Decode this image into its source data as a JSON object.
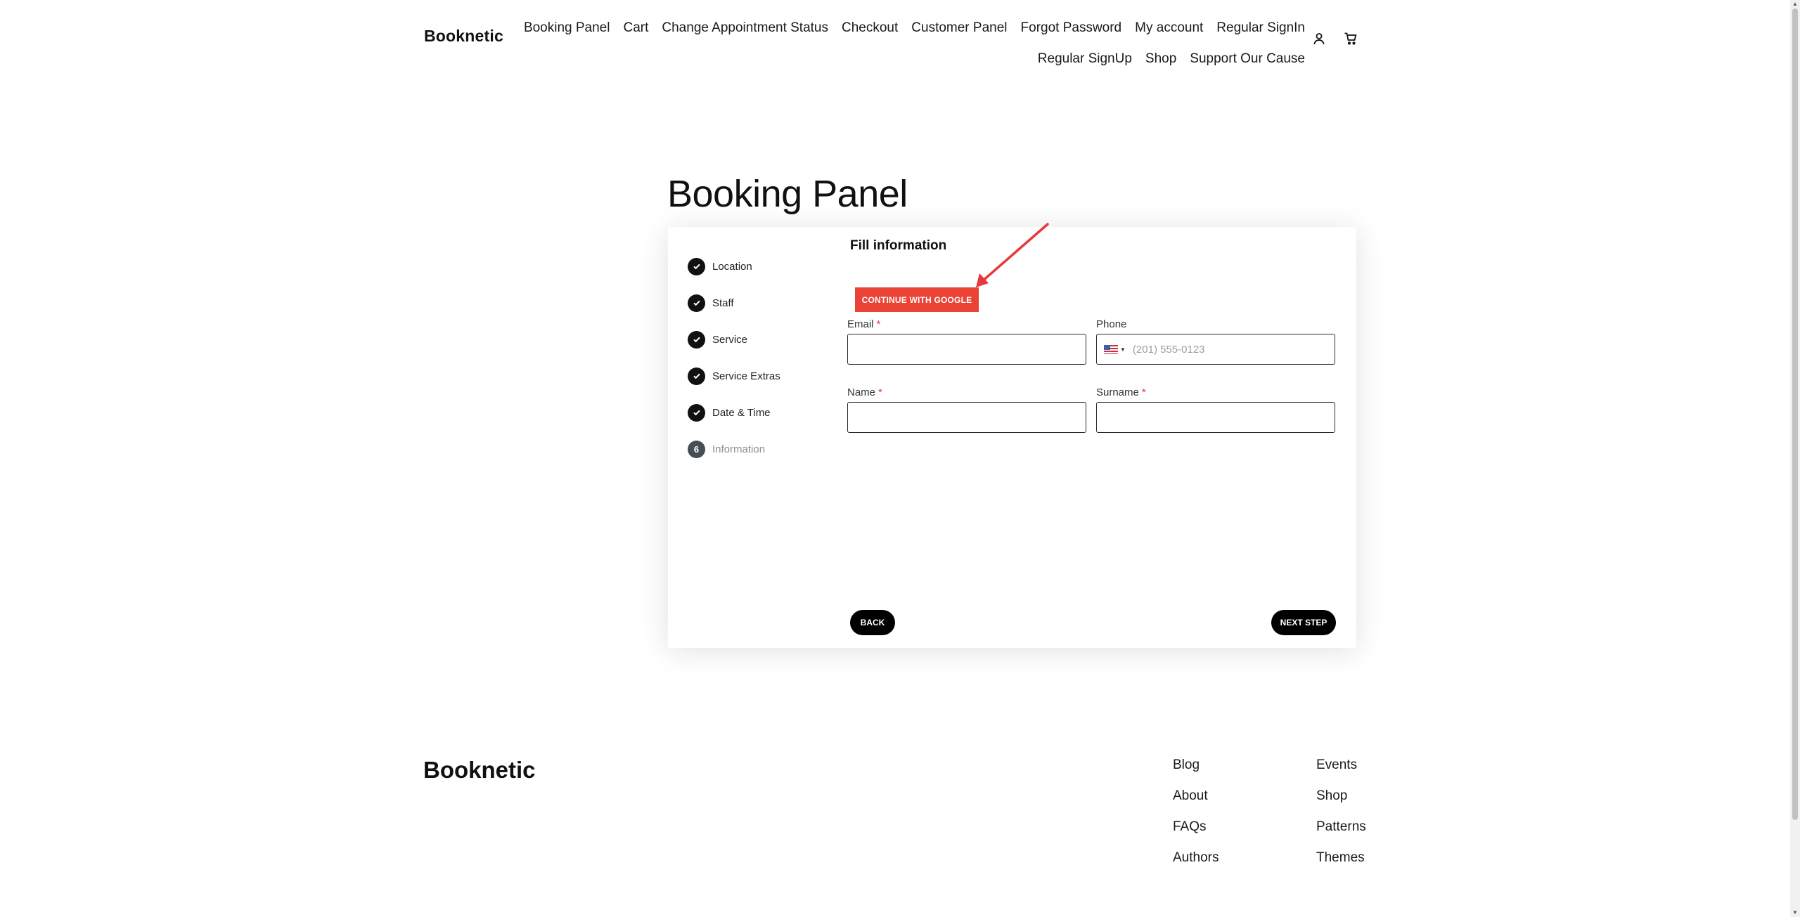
{
  "header": {
    "logo": "Booknetic",
    "nav_row1": [
      "Booking Panel",
      "Cart",
      "Change Appointment Status",
      "Checkout",
      "Customer Panel",
      "Forgot Password",
      "My account",
      "Regular SignIn"
    ],
    "nav_row2": [
      "Regular SignUp",
      "Shop",
      "Support Our Cause"
    ],
    "account_icon": "user-icon",
    "cart_icon": "cart-icon"
  },
  "page": {
    "title": "Booking Panel"
  },
  "panel": {
    "steps": [
      {
        "label": "Location",
        "done": true
      },
      {
        "label": "Staff",
        "done": true
      },
      {
        "label": "Service",
        "done": true
      },
      {
        "label": "Service Extras",
        "done": true
      },
      {
        "label": "Date & Time",
        "done": true
      },
      {
        "label": "Information",
        "done": false,
        "number": "6"
      }
    ],
    "title": "Fill information",
    "google_button": "CONTINUE WITH GOOGLE",
    "fields": {
      "email_label": "Email",
      "phone_label": "Phone",
      "phone_placeholder": "(201) 555-0123",
      "name_label": "Name",
      "surname_label": "Surname",
      "required_mark": "*"
    },
    "back_button": "BACK",
    "next_button": "NEXT STEP"
  },
  "footer": {
    "logo": "Booknetic",
    "col1": [
      "Blog",
      "About",
      "FAQs",
      "Authors"
    ],
    "col2": [
      "Events",
      "Shop",
      "Patterns",
      "Themes"
    ]
  },
  "colors": {
    "google_red": "#ea4335",
    "required": "#e0344b",
    "arrow": "#e5393c"
  }
}
